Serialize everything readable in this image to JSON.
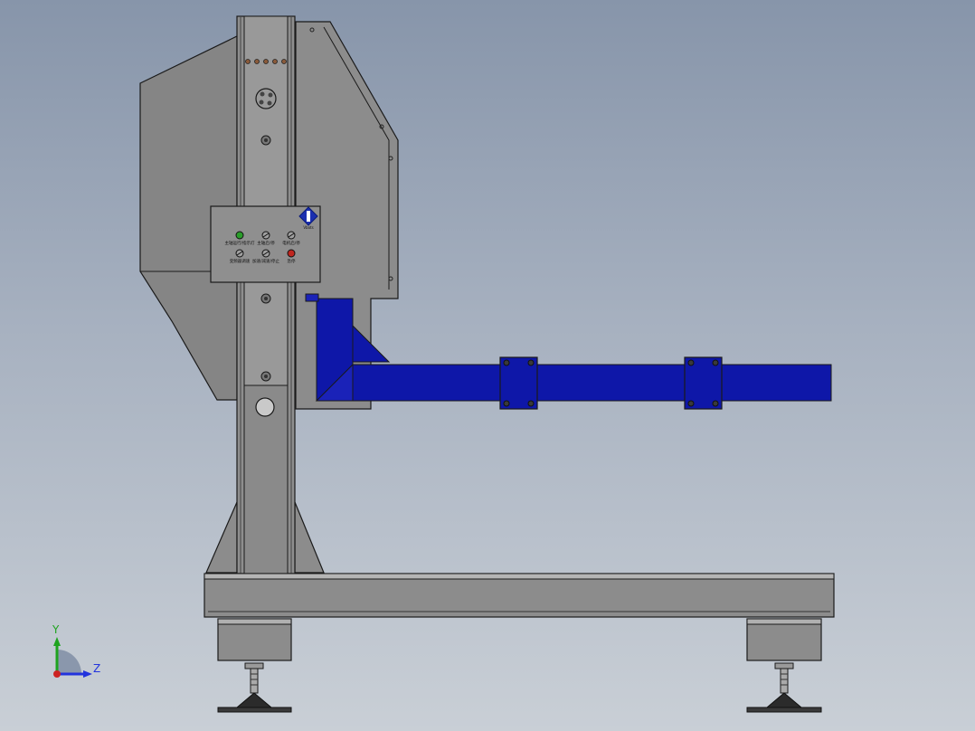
{
  "panel": {
    "logo_text": "Vbots",
    "labels": [
      "主轴运行/指示灯",
      "主轴启/停",
      "电机启/停",
      "变频器调速",
      "加速/减速/停止",
      "急停"
    ],
    "indicator_colors": {
      "green": "#2a9d2a",
      "red": "#c0261f"
    }
  },
  "triad": {
    "y_label": "Y",
    "z_label": "Z",
    "y_color": "#1fa31f",
    "z_color": "#2233dd",
    "x_color": "#cc2222"
  },
  "colors": {
    "frame": "#8a8a8a",
    "frame_light": "#a6a6a6",
    "arm_blue": "#0e17a8",
    "outline": "#1a1a1a"
  }
}
